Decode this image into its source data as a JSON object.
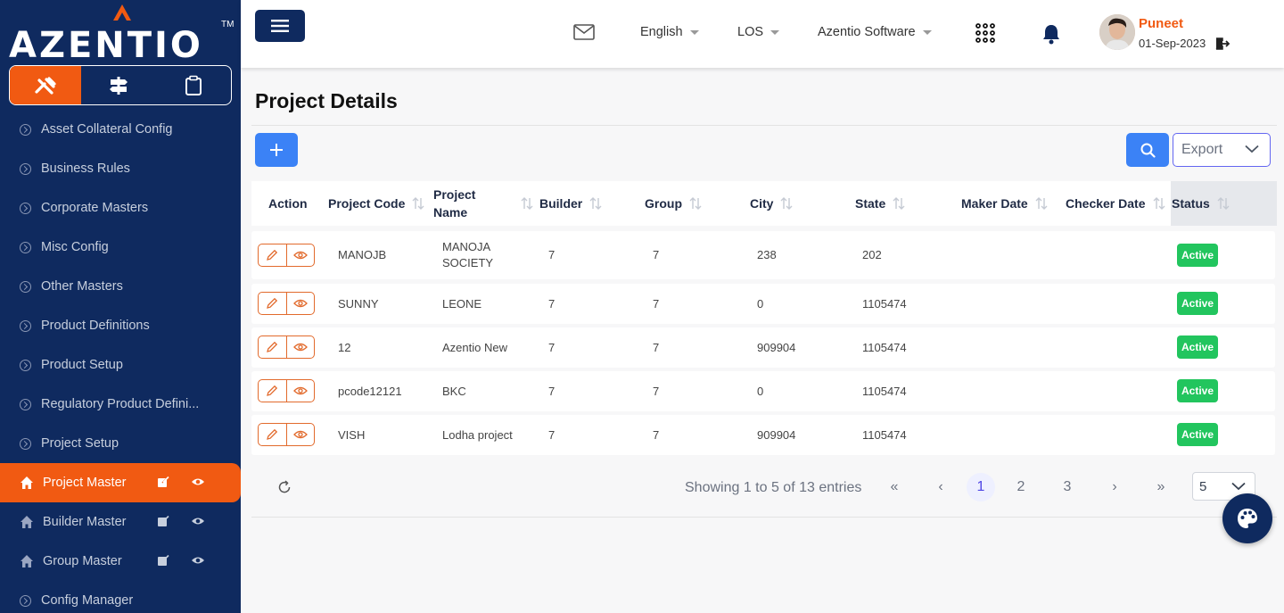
{
  "brand": {
    "name": "AZENTIO",
    "tm": "TM"
  },
  "colors": {
    "sidebar": "#0f2a5f",
    "accent": "#f15a12",
    "primary": "#3b82f6",
    "active_badge": "#22c55e"
  },
  "sidebar": {
    "tabs": [
      {
        "icon": "tools-icon",
        "active": true
      },
      {
        "icon": "signpost-icon",
        "active": false
      },
      {
        "icon": "clipboard-icon",
        "active": false
      }
    ],
    "items": [
      {
        "label": "Asset Collateral Config",
        "icon": "chevron-circle-icon"
      },
      {
        "label": "Business Rules",
        "icon": "chevron-circle-icon"
      },
      {
        "label": "Corporate Masters",
        "icon": "chevron-circle-icon"
      },
      {
        "label": "Misc Config",
        "icon": "chevron-circle-icon"
      },
      {
        "label": "Other Masters",
        "icon": "chevron-circle-icon"
      },
      {
        "label": "Product Definitions",
        "icon": "chevron-circle-icon"
      },
      {
        "label": "Product Setup",
        "icon": "chevron-circle-icon"
      },
      {
        "label": "Regulatory Product Defini...",
        "icon": "chevron-circle-icon"
      },
      {
        "label": "Project Setup",
        "icon": "chevron-circle-icon"
      },
      {
        "label": "Project Master",
        "icon": "home-icon",
        "active": true
      },
      {
        "label": "Builder Master",
        "icon": "home-icon"
      },
      {
        "label": "Group Master",
        "icon": "home-icon"
      },
      {
        "label": "Config Manager",
        "icon": "chevron-circle-icon"
      }
    ]
  },
  "header": {
    "language": "English",
    "module": "LOS",
    "company": "Azentio Software",
    "user_name": "Puneet",
    "user_date": "01-Sep-2023"
  },
  "page": {
    "title": "Project Details",
    "export_label": "Export"
  },
  "table": {
    "columns": [
      "Action",
      "Project Code",
      "Project Name",
      "Builder",
      "Group",
      "City",
      "State",
      "Maker Date",
      "Checker Date",
      "Status"
    ],
    "rows": [
      {
        "code": "MANOJB",
        "name": "MANOJA SOCIETY",
        "builder": "7",
        "group": "7",
        "city": "238",
        "state": "202",
        "maker": "",
        "checker": "",
        "status": "Active"
      },
      {
        "code": "SUNNY",
        "name": "LEONE",
        "builder": "7",
        "group": "7",
        "city": "0",
        "state": "1105474",
        "maker": "",
        "checker": "",
        "status": "Active"
      },
      {
        "code": "12",
        "name": "Azentio New",
        "builder": "7",
        "group": "7",
        "city": "909904",
        "state": "1105474",
        "maker": "",
        "checker": "",
        "status": "Active"
      },
      {
        "code": "pcode12121",
        "name": "BKC",
        "builder": "7",
        "group": "7",
        "city": "0",
        "state": "1105474",
        "maker": "",
        "checker": "",
        "status": "Active"
      },
      {
        "code": "VISH",
        "name": "Lodha project",
        "builder": "7",
        "group": "7",
        "city": "909904",
        "state": "1105474",
        "maker": "",
        "checker": "",
        "status": "Active"
      }
    ]
  },
  "pagination": {
    "summary": "Showing 1 to 5 of 13 entries",
    "pages": [
      "1",
      "2",
      "3"
    ],
    "current": "1",
    "first": "«",
    "prev": "‹",
    "next": "›",
    "last": "»",
    "per_page": "5"
  }
}
